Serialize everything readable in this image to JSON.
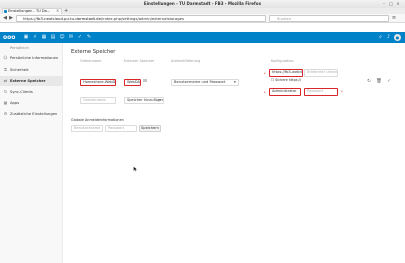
{
  "browser": {
    "window_title": "Einstellungen - TU Darmstadt - FB3 - Mozilla Firefox",
    "tab_title": "Einstellungen - TU Da...",
    "url_prefix": "https://",
    "url_host": "fb3-nextcloud.pu.tu-darmstadt.de",
    "url_path": "/index.php/settings/admin/externalstorages",
    "search_placeholder": "Suchen"
  },
  "header": {
    "logo": "ooo"
  },
  "sidebar": {
    "items": [
      {
        "label": "Persönlich"
      },
      {
        "label": "Persönliche Informationen"
      },
      {
        "label": "Sicherheit"
      },
      {
        "label": "Externe Speicher"
      },
      {
        "label": "Sync-Clients"
      },
      {
        "label": "Apps"
      },
      {
        "label": "Zusätzliche Einstellungen"
      }
    ]
  },
  "main": {
    "title": "Externe Speicher",
    "columns": {
      "folder": "Ordnername",
      "storage": "Externer Speicher",
      "auth": "Authentifizierung",
      "config": "Konfiguration"
    },
    "row": {
      "folder_value": "Homeshare-WebDAV",
      "storage_value": "WebDAV",
      "auth_value": "Benutzername und Passwort",
      "url_value": "https://fb3-webdav.tu",
      "remote_sub_placeholder": "Entfernter Unterordner",
      "secure_label": "Sichere https://",
      "user_value": "Administrator",
      "password_placeholder": "Passwort"
    },
    "new_row": {
      "folder_placeholder": "Ordnername",
      "storage_select": "Speicher hinzufügen"
    },
    "global": {
      "label": "Globale Anmeldeinformationen",
      "user_placeholder": "Benutzername",
      "password_placeholder": "Passwort",
      "save_label": "Speichern"
    }
  },
  "colors": {
    "brand": "#0082c9",
    "highlight": "#d8262a"
  }
}
